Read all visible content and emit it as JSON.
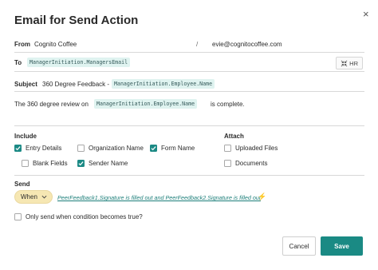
{
  "dialog": {
    "title": "Email for Send Action",
    "close_glyph": "×"
  },
  "from": {
    "label": "From",
    "name": "Cognito Coffee",
    "separator": "/",
    "email": "evie@cognitocoffee.com"
  },
  "to": {
    "label": "To",
    "token": "ManagerInitiation.ManagersEmail",
    "hr_button": "HR",
    "hr_icon": "collapse-arrows-icon"
  },
  "subject": {
    "label": "Subject",
    "prefix": "360 Degree Feedback -",
    "token": "ManagerInitiation.Employee.Name"
  },
  "body": {
    "before": "The 360 degree review on",
    "token": "ManagerInitiation.Employee.Name",
    "after": "is complete."
  },
  "include": {
    "title": "Include",
    "options": [
      {
        "label": "Entry Details",
        "checked": true
      },
      {
        "label": "Organization Name",
        "checked": false
      },
      {
        "label": "Form Name",
        "checked": true
      },
      {
        "label": "Blank Fields",
        "checked": false
      },
      {
        "label": "Sender Name",
        "checked": true
      }
    ]
  },
  "attach": {
    "title": "Attach",
    "options": [
      {
        "label": "Uploaded Files",
        "checked": false
      },
      {
        "label": "Documents",
        "checked": false
      }
    ]
  },
  "send": {
    "title": "Send",
    "when_label": "When",
    "condition_link": "PeerFeedback1.Signature is filled out and PeerFeedback2.Signature is filled out",
    "bolt_icon": "lightning-icon",
    "only_send_label": "Only send when condition becomes true?",
    "only_send_checked": false
  },
  "actions": {
    "cancel_label": "Cancel",
    "save_label": "Save"
  },
  "colors": {
    "accent": "#1a8a84",
    "token_bg": "#dff3f0",
    "when_bg": "#f6e7b3"
  }
}
